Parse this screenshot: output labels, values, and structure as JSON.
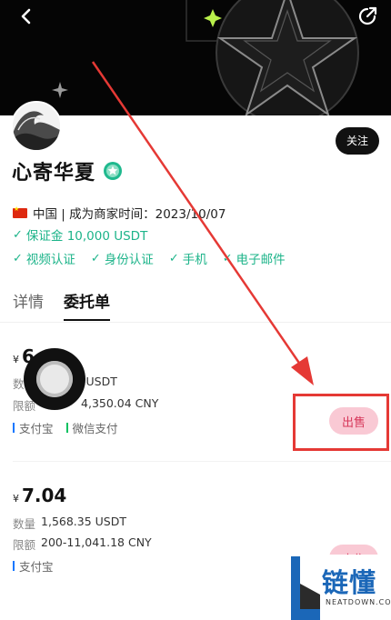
{
  "header": {
    "back_icon": "chevron-left-icon",
    "share_icon": "share-arrow-icon"
  },
  "profile": {
    "name": "心寄华夏",
    "follow_label": "关注",
    "location_info": "中国 | 成为商家时间：2023/10/07",
    "deposit": "保证金 10,000 USDT",
    "verifications": [
      "视频认证",
      "身份认证",
      "手机",
      "电子邮件"
    ]
  },
  "tabs": [
    {
      "label": "详情",
      "active": false
    },
    {
      "label": "委托单",
      "active": true
    }
  ],
  "orders": [
    {
      "currency_symbol": "¥",
      "price": "6",
      "quantity_label": "数",
      "quantity_value": "USDT",
      "limit_label": "限额",
      "limit_value": "4,350.04 CNY",
      "payment_methods": [
        "支付宝",
        "微信支付"
      ],
      "action_label": "出售"
    },
    {
      "currency_symbol": "¥",
      "price": "7.04",
      "quantity_label": "数量",
      "quantity_value": "1,568.35 USDT",
      "limit_label": "限额",
      "limit_value": "200-11,041.18 CNY",
      "payment_methods": [
        "支付宝"
      ],
      "action_label": "出售"
    }
  ],
  "watermark": {
    "brand": "链懂",
    "url": "NEATDOWN.COM"
  },
  "colors": {
    "accent_green": "#1db48a",
    "sell_bg": "#f9c9d4",
    "sell_text": "#d7375a",
    "annotation_red": "#e53935"
  }
}
